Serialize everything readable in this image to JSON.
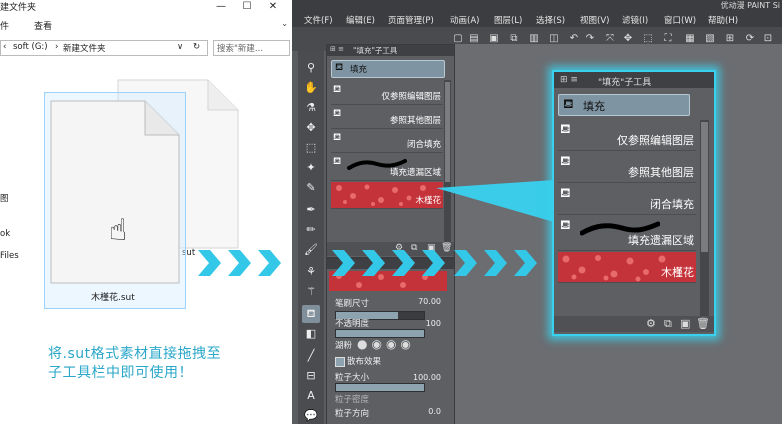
{
  "explorer": {
    "title": "建文件夹",
    "window_buttons": {
      "minimize": "—",
      "maximize": "☐",
      "close": "✕"
    },
    "menu": [
      "件",
      "查看"
    ],
    "address": {
      "back": "‹",
      "drive": "soft (G:)",
      "sep": "›",
      "folder": "新建文件夹",
      "dropdown": "∨",
      "refresh": "↻"
    },
    "search_placeholder": "搜索\"新建...",
    "sidebar": [
      "图",
      "ok",
      "Files"
    ],
    "file_label": "木槿花.sut",
    "file_back_label": "sut",
    "caption_line1": "将.sut格式素材直接拖拽至",
    "caption_line2": "子工具栏中即可使用！"
  },
  "app": {
    "title": "优动漫 PAINT Si",
    "menu": [
      "文件(F)",
      "编辑(E)",
      "页面管理(P)",
      "动画(A)",
      "图层(L)",
      "选择(S)",
      "视图(V)",
      "滤镜(I)",
      "窗口(W)",
      "帮助(H)"
    ],
    "subtool_tab": "\"填充\"子工具",
    "group_label": "填充",
    "subtools": [
      {
        "icon": "paint-bucket",
        "label": "仅参照编辑图层"
      },
      {
        "icon": "paint-bucket",
        "label": "参照其他图层"
      },
      {
        "icon": "paint-bucket",
        "label": "闭合填充"
      },
      {
        "icon": "brush-stroke",
        "label": "填充遗漏区域"
      },
      {
        "icon": "red-texture",
        "label": "木槿花"
      }
    ],
    "tool_property": {
      "brush_size_label": "笔刷尺寸",
      "brush_size_value": "70.00",
      "brush_size_fraction": 0.7,
      "opacity_label": "不透明度",
      "opacity_value": "100",
      "opacity_fraction": 1.0,
      "blend_label": "湖粉",
      "scatter_label": "散布效果",
      "particle_size_label": "粒子大小",
      "particle_size_value": "100.00",
      "particle_size_fraction": 1.0,
      "particle_density_label": "粒子密度",
      "particle_direction_label": "粒子方向",
      "particle_direction_value": "0.0"
    }
  },
  "colors": {
    "accent": "#38d2ee",
    "caption": "#2aa7c9",
    "panel": "#5d5f63",
    "texture": "#c4323a"
  }
}
